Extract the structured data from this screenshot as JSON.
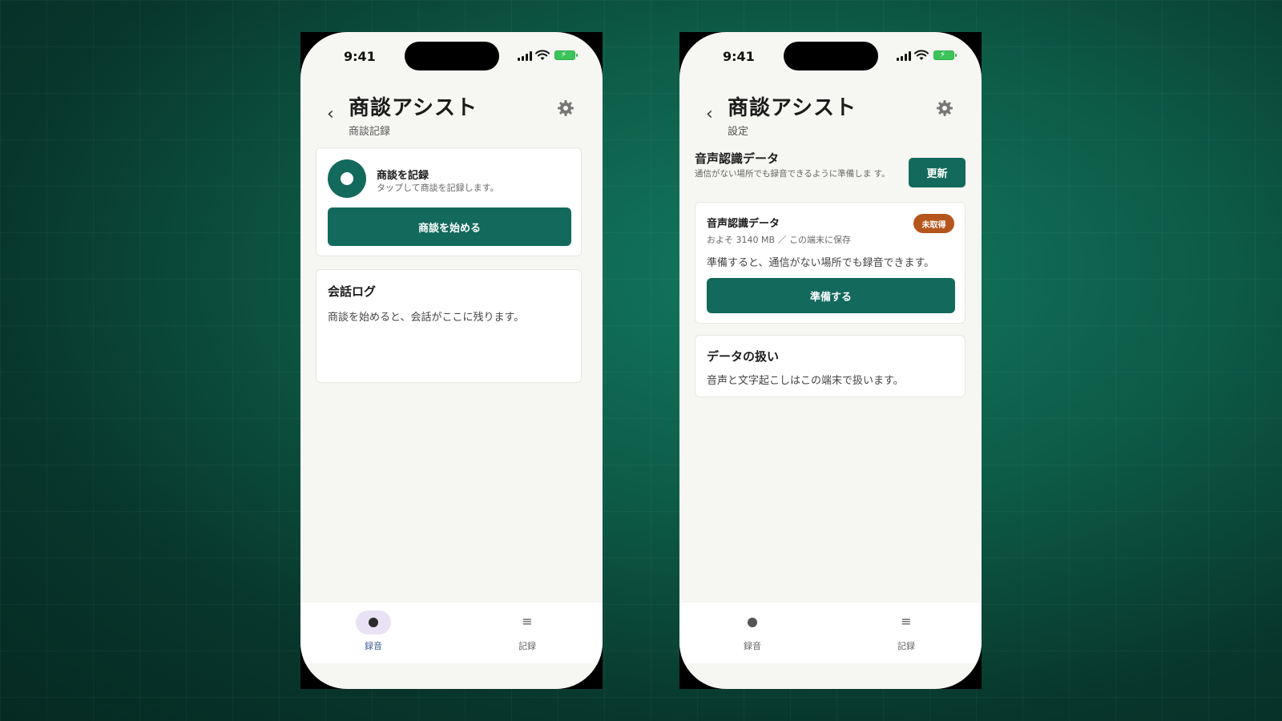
{
  "status_bar": {
    "time": "9:41"
  },
  "icons": {
    "back": "chevron-left-icon",
    "settings": "gear-icon",
    "record": "record-icon",
    "menu": "list-icon"
  },
  "colors": {
    "primary": "#12695c",
    "badge": "#b5561c",
    "tab_active_bg": "#e9e2f5"
  },
  "screen1": {
    "app_title": "商談アシスト",
    "subtitle": "商談記録",
    "record_card": {
      "title": "商談を記録",
      "description": "タップして商談を記録します。",
      "button_label": "商談を始める"
    },
    "log_card": {
      "title": "会話ログ",
      "empty_text": "商談を始めると、会話がここに残ります。"
    },
    "tabs": [
      {
        "label": "録音",
        "active": true
      },
      {
        "label": "記録",
        "active": false
      }
    ]
  },
  "screen2": {
    "app_title": "商談アシスト",
    "subtitle": "設定",
    "section": {
      "title": "音声認識データ",
      "description": "通信がない場所でも録音できるように準備しま す。",
      "update_button": "更新"
    },
    "data_card": {
      "title": "音声認識データ",
      "badge": "未取得",
      "meta": "およそ 3140 MB ／ この端末に保存",
      "info": "準備すると、通信がない場所でも録音できます。",
      "button_label": "準備する"
    },
    "handling_card": {
      "title": "データの扱い",
      "text": "音声と文字起こしはこの端末で扱います。"
    },
    "tabs": [
      {
        "label": "録音",
        "active": false
      },
      {
        "label": "記録",
        "active": false
      }
    ]
  }
}
